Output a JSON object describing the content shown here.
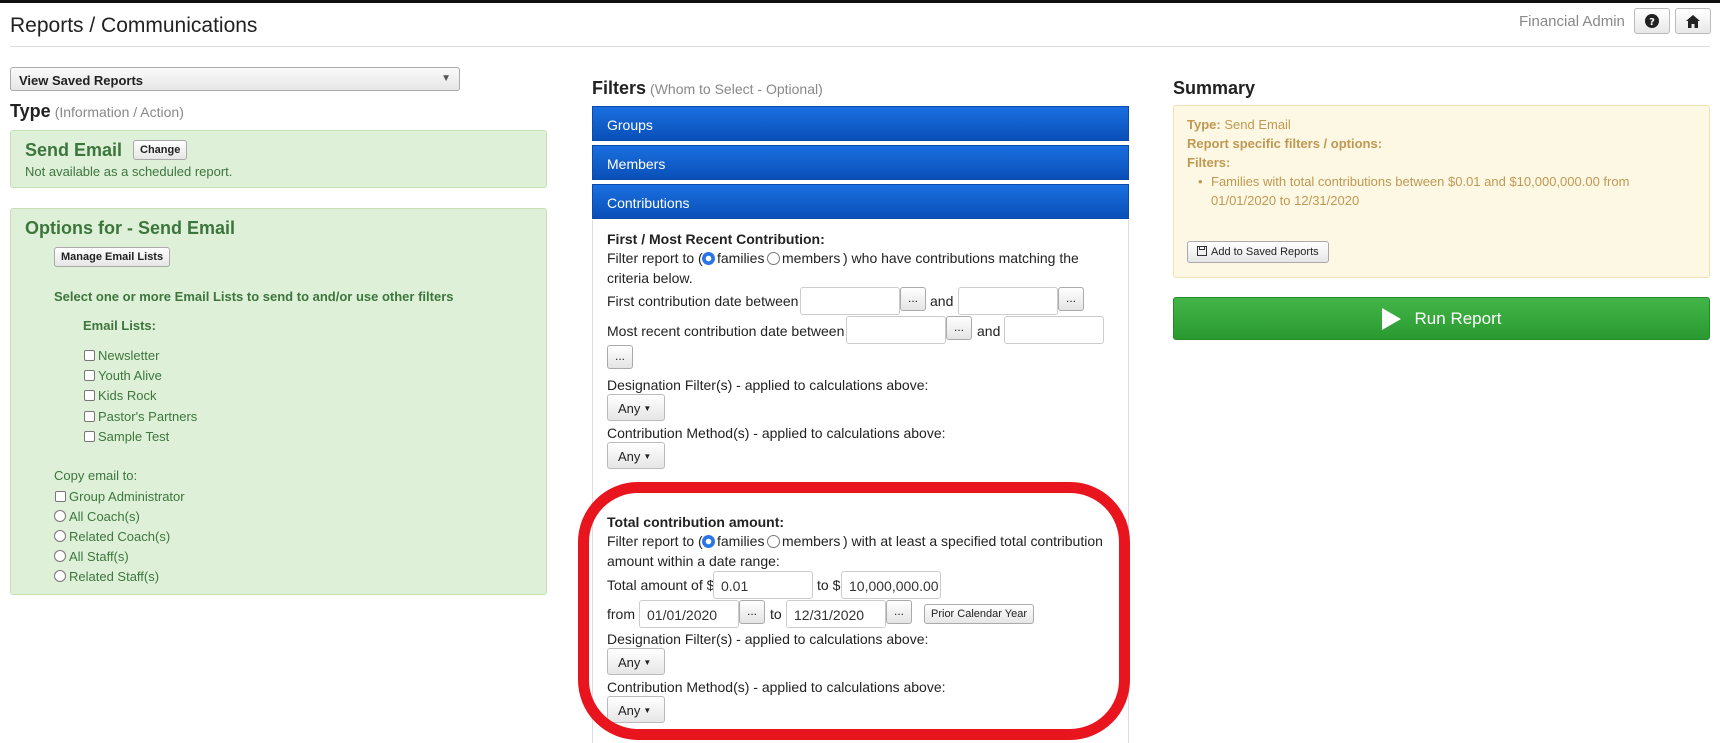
{
  "header": {
    "title": "Reports / Communications",
    "user": "Financial Admin",
    "help_icon": "question-circle-icon",
    "home_icon": "home-icon"
  },
  "left": {
    "saved_reports_label": "View Saved Reports",
    "type_heading": "Type",
    "type_sub": "(Information / Action)",
    "send_email_title": "Send Email",
    "change_label": "Change",
    "not_available": "Not available as a scheduled report.",
    "options_title": "Options for - Send Email",
    "manage_lists_label": "Manage Email Lists",
    "select_instruction": "Select one or more Email Lists to send to and/or use other filters",
    "email_lists_heading": "Email Lists:",
    "email_lists": [
      "Newsletter",
      "Youth Alive",
      "Kids Rock",
      "Pastor's Partners",
      "Sample Test"
    ],
    "copy_heading": "Copy email to:",
    "copy_options": [
      "Group Administrator",
      "All Coach(s)",
      "Related Coach(s)",
      "All Staff(s)",
      "Related Staff(s)"
    ]
  },
  "filters": {
    "heading": "Filters",
    "sub": "(Whom to Select - Optional)",
    "groups_label": "Groups",
    "members_label": "Members",
    "contributions_label": "Contributions",
    "first_recent": {
      "heading": "First / Most Recent Contribution:",
      "filter_prefix": "Filter report to (",
      "families": "families",
      "members": "members",
      "filter_suffix": ") who have contributions matching the",
      "filter_line2": "criteria below.",
      "first_date_label": "First contribution date between",
      "and": "and",
      "recent_date_label": "Most recent contribution date between",
      "dots": "...",
      "designation_label": "Designation Filter(s) - applied to calculations above:",
      "method_label": "Contribution Method(s) - applied to calculations above:",
      "any": "Any"
    },
    "total": {
      "heading": "Total contribution amount:",
      "filter_prefix": "Filter report to (",
      "families": "families",
      "members": "members",
      "filter_suffix": ") with at least a specified total contribution",
      "filter_line2": "amount within a date range:",
      "amount_label": "Total amount of $",
      "amount_from": "0.01",
      "to_dollar": "to $",
      "amount_to": "10,000,000.00",
      "from": "from",
      "date_from": "01/01/2020",
      "to": "to",
      "date_to": "12/31/2020",
      "prior_year_label": "Prior Calendar Year",
      "designation_label": "Designation Filter(s) - applied to calculations above:",
      "method_label": "Contribution Method(s) - applied to calculations above:",
      "any": "Any"
    }
  },
  "summary": {
    "heading": "Summary",
    "type_label": "Type:",
    "type_value": "Send Email",
    "report_specific": "Report specific filters / options:",
    "filters_label": "Filters:",
    "filter_item_line1": "Families with total contributions between $0.01 and $10,000,000.00 from",
    "filter_item_line2": "01/01/2020 to 12/31/2020",
    "add_saved_label": "Add to Saved Reports",
    "run_label": "Run Report",
    "accent_red": "#e8141e"
  }
}
